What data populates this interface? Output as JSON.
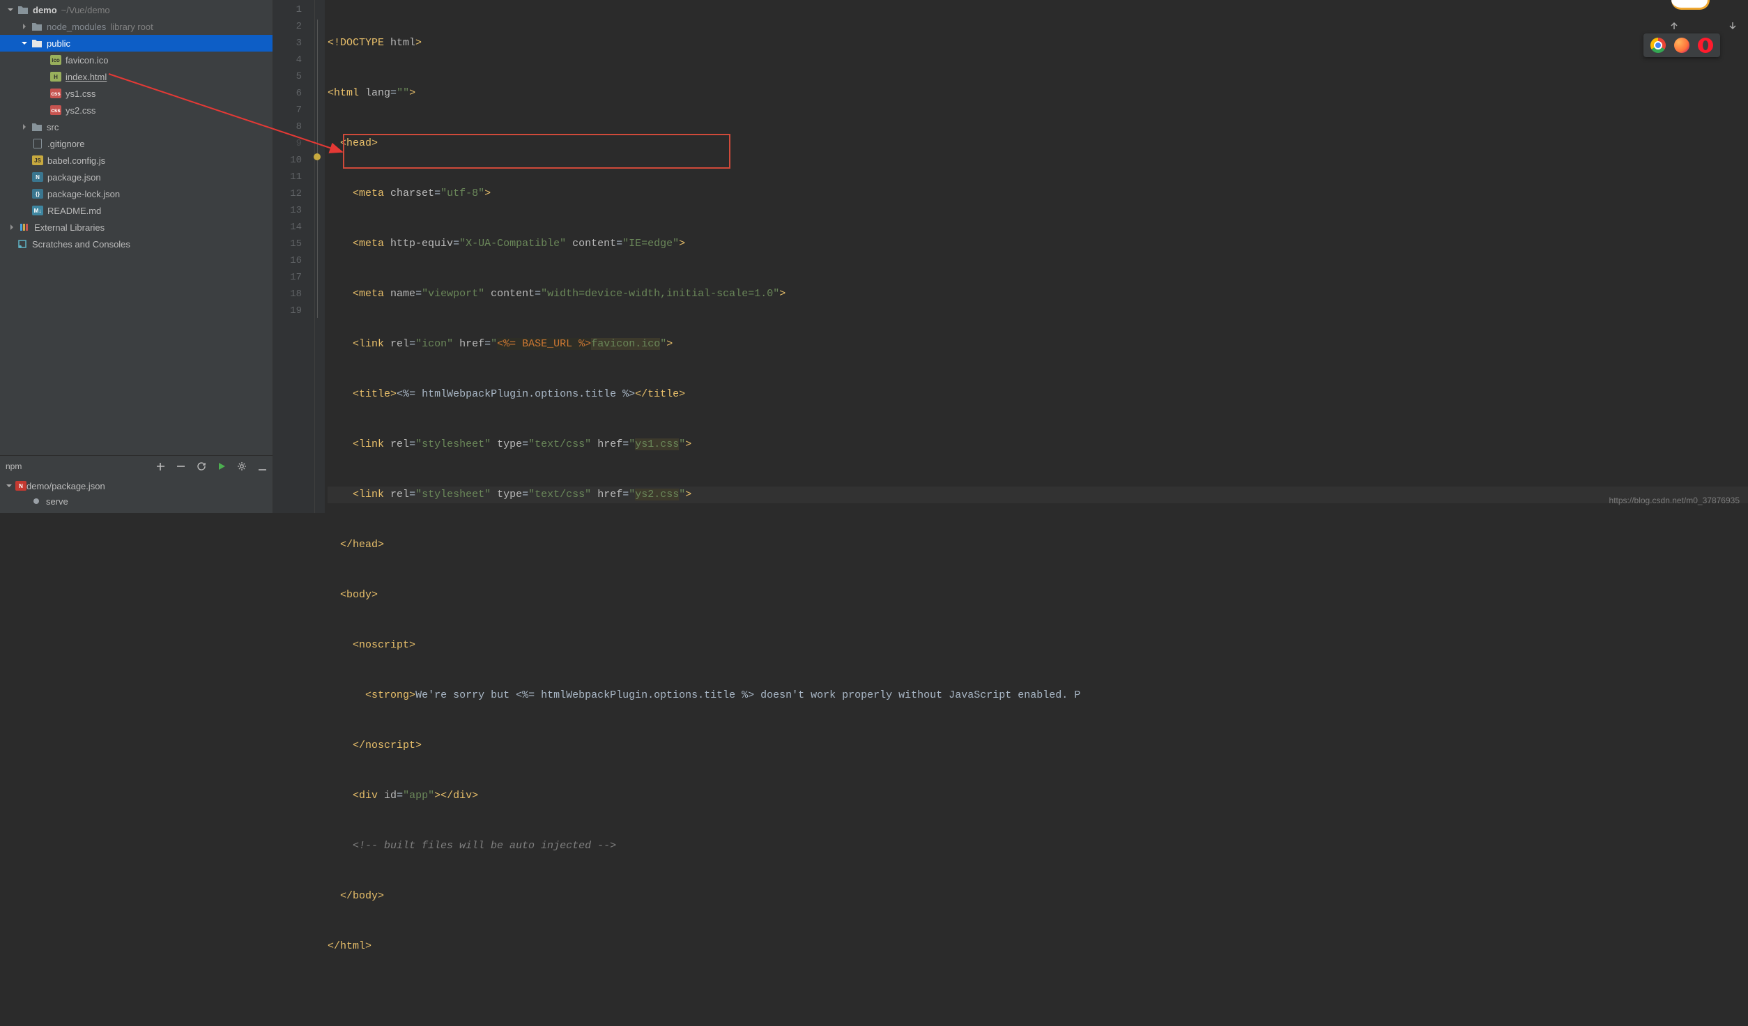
{
  "project": {
    "root": {
      "name": "demo",
      "path": "~/Vue/demo"
    },
    "node_modules": {
      "name": "node_modules",
      "tag": "library root"
    },
    "public": {
      "name": "public"
    },
    "files": {
      "favicon": "favicon.ico",
      "index": "index.html",
      "ys1": "ys1.css",
      "ys2": "ys2.css"
    },
    "src": {
      "name": "src"
    },
    "rootFiles": {
      "gitignore": ".gitignore",
      "babel": "babel.config.js",
      "pkg": "package.json",
      "pkglock": "package-lock.json",
      "readme": "README.md"
    },
    "external": "External Libraries",
    "scratches": "Scratches and Consoles"
  },
  "npmPanel": {
    "title": "npm",
    "target": "demo/package.json",
    "script": "serve"
  },
  "editor": {
    "lines": [
      "<!DOCTYPE html>",
      "<html lang=\"\">",
      "  <head>",
      "    <meta charset=\"utf-8\">",
      "    <meta http-equiv=\"X-UA-Compatible\" content=\"IE=edge\">",
      "    <meta name=\"viewport\" content=\"width=device-width,initial-scale=1.0\">",
      "    <link rel=\"icon\" href=\"<%= BASE_URL %>favicon.ico\">",
      "    <title><%= htmlWebpackPlugin.options.title %></title>",
      "    <link rel=\"stylesheet\" type=\"text/css\" href=\"ys1.css\">",
      "    <link rel=\"stylesheet\" type=\"text/css\" href=\"ys2.css\">",
      "  </head>",
      "  <body>",
      "    <noscript>",
      "      <strong>We're sorry but <%= htmlWebpackPlugin.options.title %> doesn't work properly without JavaScript enabled. P",
      "    </noscript>",
      "    <div id=\"app\"></div>",
      "    <!-- built files will be auto injected -->",
      "  </body>",
      "</html>"
    ],
    "lineNumbers": [
      "1",
      "2",
      "3",
      "4",
      "5",
      "6",
      "7",
      "8",
      "9",
      "10",
      "11",
      "12",
      "13",
      "14",
      "15",
      "16",
      "17",
      "18",
      "19"
    ]
  },
  "watermark": "https://blog.csdn.net/m0_37876935"
}
